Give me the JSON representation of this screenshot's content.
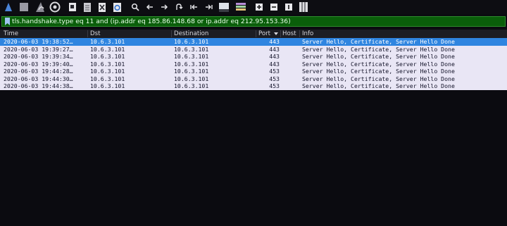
{
  "filter": {
    "text": "tls.handshake.type eq 11 and (ip.addr eq 185.86.148.68 or ip.addr eq 212.95.153.36)"
  },
  "columns": {
    "time": "Time",
    "dst": "Dst",
    "destination": "Destination",
    "port": "Port",
    "host": "Host",
    "info": "Info"
  },
  "packets": [
    {
      "time": "2020-06-03 19:38:52…",
      "dst": "10.6.3.101",
      "destination": "10.6.3.101",
      "port": "443",
      "host": "",
      "info": "Server Hello, Certificate, Server Hello Done"
    },
    {
      "time": "2020-06-03 19:39:27…",
      "dst": "10.6.3.101",
      "destination": "10.6.3.101",
      "port": "443",
      "host": "",
      "info": "Server Hello, Certificate, Server Hello Done"
    },
    {
      "time": "2020-06-03 19:39:34…",
      "dst": "10.6.3.101",
      "destination": "10.6.3.101",
      "port": "443",
      "host": "",
      "info": "Server Hello, Certificate, Server Hello Done"
    },
    {
      "time": "2020-06-03 19:39:40…",
      "dst": "10.6.3.101",
      "destination": "10.6.3.101",
      "port": "443",
      "host": "",
      "info": "Server Hello, Certificate, Server Hello Done"
    },
    {
      "time": "2020-06-03 19:44:28…",
      "dst": "10.6.3.101",
      "destination": "10.6.3.101",
      "port": "453",
      "host": "",
      "info": "Server Hello, Certificate, Server Hello Done"
    },
    {
      "time": "2020-06-03 19:44:30…",
      "dst": "10.6.3.101",
      "destination": "10.6.3.101",
      "port": "453",
      "host": "",
      "info": "Server Hello, Certificate, Server Hello Done"
    },
    {
      "time": "2020-06-03 19:44:38…",
      "dst": "10.6.3.101",
      "destination": "10.6.3.101",
      "port": "453",
      "host": "",
      "info": "Server Hello, Certificate, Server Hello Done"
    }
  ],
  "colors": {
    "filter_valid_bg": "#0a5e0a",
    "selected_row": "#2f85e0",
    "row_bg": "#e9e6f5"
  }
}
